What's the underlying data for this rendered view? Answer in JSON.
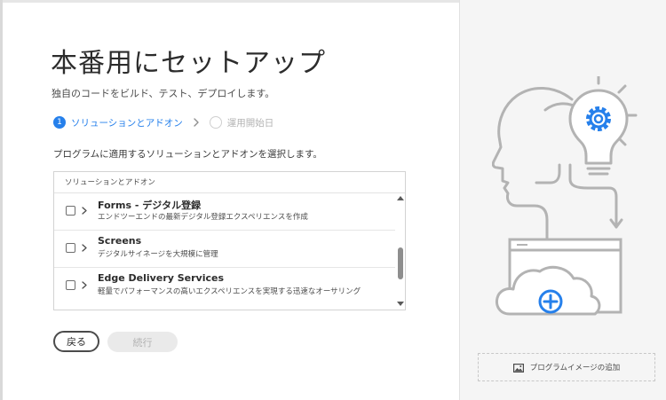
{
  "dialog": {
    "title": "本番用にセットアップ",
    "subtitle": "独自のコードをビルド、テスト、デプロイします。"
  },
  "stepper": {
    "step1_number": "1",
    "step1_label": "ソリューションとアドオン",
    "step2_label": "運用開始日"
  },
  "description": "プログラムに適用するソリューションとアドオンを選択します。",
  "list": {
    "header": "ソリューションとアドオン",
    "items": [
      {
        "title": "Forms - デジタル登録",
        "description": "エンドツーエンドの最新デジタル登録エクスペリエンスを作成"
      },
      {
        "title": "Screens",
        "description": "デジタルサイネージを大規模に管理"
      },
      {
        "title": "Edge Delivery Services",
        "description": "軽量でパフォーマンスの高いエクスペリエンスを実現する迅速なオーサリング"
      }
    ]
  },
  "buttons": {
    "back": "戻る",
    "next": "続行"
  },
  "right_panel": {
    "add_image_label": "プログラムイメージの追加"
  },
  "colors": {
    "accent": "#2680eb",
    "illustration_gray": "#b3b3b3"
  }
}
